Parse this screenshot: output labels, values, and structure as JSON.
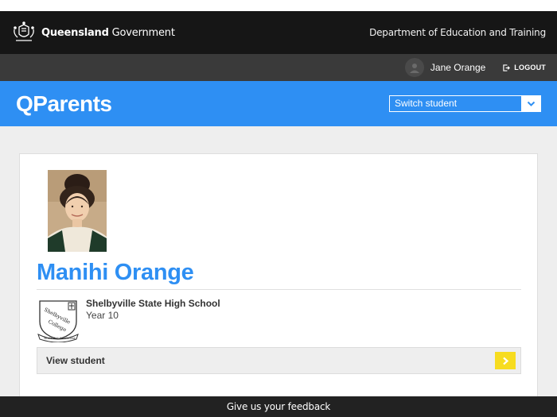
{
  "government": {
    "name_bold": "Queensland",
    "name_regular": "Government",
    "department": "Department of Education and Training"
  },
  "user": {
    "name": "Jane Orange",
    "logout_label": "LOGOUT"
  },
  "brand": {
    "title": "QParents",
    "switch_student_label": "Switch student"
  },
  "student": {
    "name": "Manihi Orange",
    "school_name": "Shelbyville State High School",
    "year": "Year 10",
    "view_label": "View student"
  },
  "school_logo": {
    "top_text": "Shelbyville",
    "bottom_text": "College",
    "motto": "Tenete Multi Excellentiae"
  },
  "footer": {
    "feedback_label": "Give us your feedback"
  },
  "colors": {
    "brand_blue": "#2e8ff3",
    "gov_bar": "#161616",
    "user_bar": "#3a3a3a",
    "view_button": "#f7dc1f",
    "feedback_bar": "#222222"
  },
  "icons": [
    "queensland-crest-icon",
    "user-avatar-icon",
    "logout-icon",
    "chevron-down-icon",
    "chevron-right-icon",
    "school-crest-icon"
  ]
}
